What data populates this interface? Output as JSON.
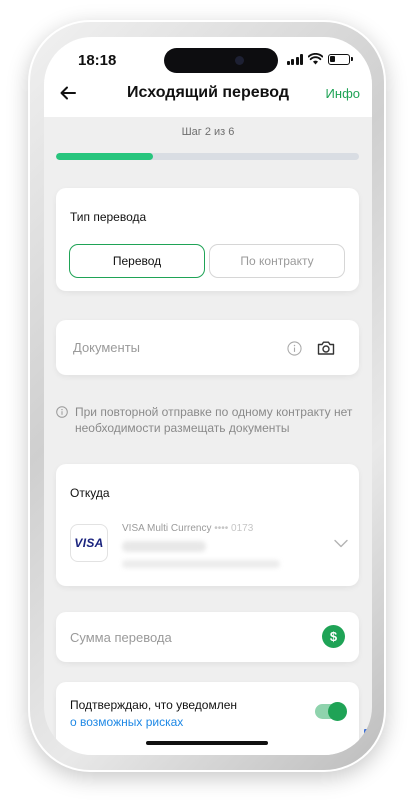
{
  "status_bar": {
    "time": "18:18"
  },
  "header": {
    "title": "Исходящий перевод",
    "info_label": "Инфо"
  },
  "stepper": {
    "label": "Шаг 2 из 6",
    "progress_fraction": 0.32
  },
  "transfer_type": {
    "heading": "Тип перевода",
    "options": [
      "Перевод",
      "По контракту"
    ],
    "selected": "Перевод"
  },
  "documents": {
    "placeholder": "Документы"
  },
  "hint": {
    "text": "При повторной отправке по одному контракту нет необходимости размещать документы"
  },
  "from_account": {
    "heading": "Откуда",
    "card_brand": "VISA",
    "card_name": "VISA Multi Currency",
    "card_mask": "•••• 0173"
  },
  "amount": {
    "placeholder": "Сумма перевода"
  },
  "risk_confirm": {
    "text": "Подтверждаю, что уведомлен",
    "link": "о возможных рисках",
    "enabled": true
  },
  "colors": {
    "accent": "#1fa356",
    "progress": "#27c57d",
    "link": "#1e88e5"
  },
  "icons": [
    "back-arrow-icon",
    "info-circle-icon",
    "camera-icon",
    "chevron-down-icon",
    "dollar-icon"
  ]
}
